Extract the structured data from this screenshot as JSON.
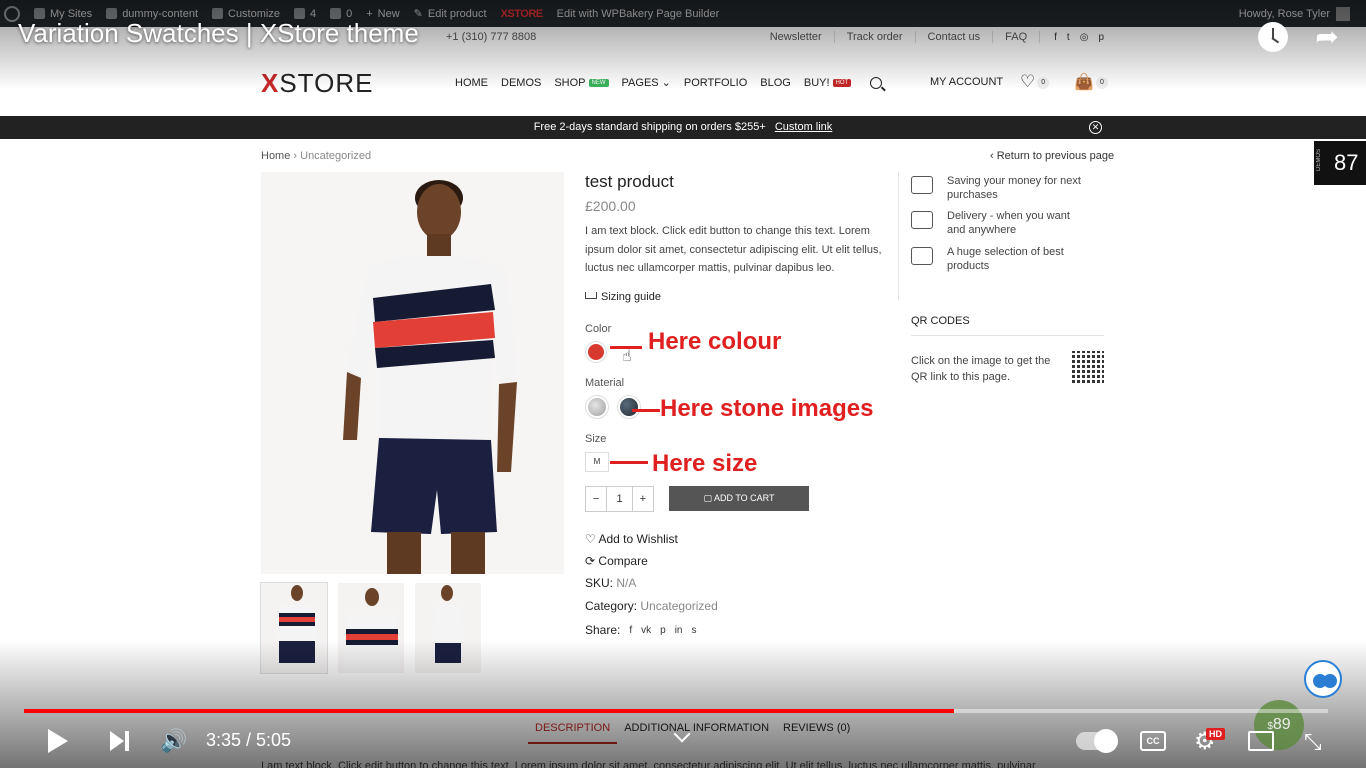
{
  "video": {
    "title": "Variation Swatches | XStore theme",
    "time": "3:35 / 5:05",
    "progress": 0.713,
    "cc_label": "CC",
    "hd_label": "HD",
    "notif_count": "89",
    "share_arrow": "➦",
    "volume_glyph": "🔊",
    "gear_glyph": "⚙",
    "fullscreen_glyph": "⤡"
  },
  "wp_admin": {
    "items": [
      "My Sites",
      "dummy-content",
      "Customize",
      "4",
      "0",
      "New",
      "Edit product",
      "XSTORE",
      "Edit with WPBakery Page Builder"
    ],
    "howdy": "Howdy, Rose Tyler"
  },
  "topbar": {
    "phone": "+1 (310) 777 8808",
    "links": [
      "Newsletter",
      "Track order",
      "Contact us",
      "FAQ"
    ],
    "social": [
      "f",
      "t",
      "◎",
      "p"
    ]
  },
  "header": {
    "logo_x": "X",
    "logo_rest": "STORE",
    "nav": [
      {
        "label": "HOME"
      },
      {
        "label": "DEMOS"
      },
      {
        "label": "SHOP",
        "badge": "NEW"
      },
      {
        "label": "PAGES ⌄"
      },
      {
        "label": "PORTFOLIO"
      },
      {
        "label": "BLOG"
      },
      {
        "label": "BUY!",
        "badge": "HOT"
      }
    ],
    "account": "MY ACCOUNT",
    "wishlist_count": "0",
    "cart_count": "0",
    "heart_glyph": "♡",
    "bag_glyph": "👜"
  },
  "shipping": {
    "text": "Free 2-days standard shipping on orders $255+",
    "link": "Custom link",
    "close_glyph": "✕"
  },
  "breadcrumb": {
    "home": "Home",
    "sep": " › ",
    "current": "Uncategorized",
    "back": "‹ Return to previous page"
  },
  "demos": {
    "label": "DEMOS",
    "count": "87"
  },
  "product": {
    "title": "test product",
    "price": "£200.00",
    "description": "I am text block. Click edit button to change this text. Lorem ipsum dolor sit amet, consectetur adipiscing elit. Ut elit tellus, luctus nec ullamcorper mattis, pulvinar dapibus leo.",
    "sizing_guide": "Sizing guide",
    "color_label": "Color",
    "material_label": "Material",
    "size_label": "Size",
    "size_value": "M",
    "qty": "1",
    "qty_minus": "−",
    "qty_plus": "+",
    "add_to_cart": "▢ ADD TO CART",
    "wishlist": "Add to Wishlist",
    "compare": "Compare",
    "sku_label": "SKU:",
    "sku_value": "N/A",
    "category_label": "Category:",
    "category_value": "Uncategorized",
    "share_label": "Share:",
    "share_icons": [
      "f",
      "vk",
      "p",
      "in",
      "s"
    ],
    "heart_glyph": "♡",
    "compare_glyph": "⟳",
    "cursor_glyph": "☝",
    "swatch_color": "#d83a31"
  },
  "annotations": {
    "colour": "Here colour",
    "stone": "Here stone images",
    "size": "Here size",
    "color": "#e02020"
  },
  "features": [
    {
      "text": "Saving your money for next purchases"
    },
    {
      "text": "Delivery - when you want and anywhere"
    },
    {
      "text": "A huge selection of best products"
    }
  ],
  "qr": {
    "heading": "QR CODES",
    "text": "Click on the image to get the QR link to this page."
  },
  "tabs": [
    "DESCRIPTION",
    "ADDITIONAL INFORMATION",
    "REVIEWS (0)"
  ],
  "below_text": "I am text block. Click edit button to change this text. Lorem ipsum dolor sit amet, consectetur adipiscing elit. Ut elit tellus, luctus nec ullamcorper mattis, pulvinar"
}
